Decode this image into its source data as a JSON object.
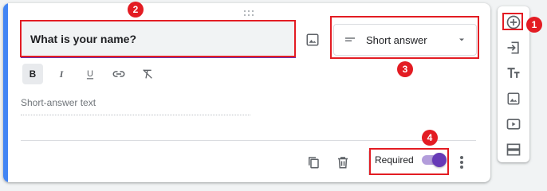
{
  "question": {
    "title": "What is your name?"
  },
  "question_type": {
    "label": "Short answer",
    "icon": "short-answer-lines-icon"
  },
  "format_bar": [
    "bold-icon",
    "italic-icon",
    "underline-icon",
    "link-icon",
    "clear-formatting-icon"
  ],
  "answer": {
    "placeholder": "Short-answer text"
  },
  "footer": {
    "required_label": "Required",
    "required_on": true
  },
  "sidebar": [
    "add-question-icon",
    "import-questions-icon",
    "add-title-icon",
    "add-image-icon",
    "add-video-icon",
    "add-section-icon"
  ],
  "callouts": [
    "1",
    "2",
    "3",
    "4"
  ],
  "colors": {
    "accent": "#673ab7",
    "card_bar": "#4285f4",
    "callout": "#e31c23"
  }
}
